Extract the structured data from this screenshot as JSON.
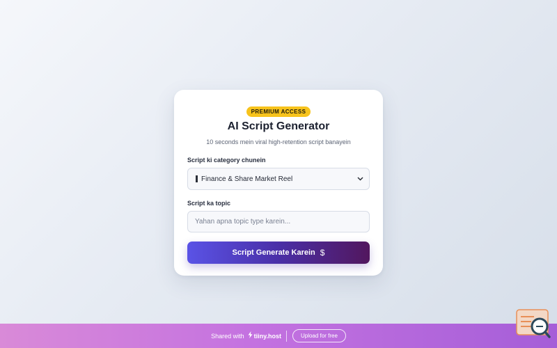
{
  "card": {
    "badge": "PREMIUM ACCESS",
    "title": "AI Script Generator",
    "subtitle": "10 seconds mein viral high-retention script banayein",
    "category": {
      "label": "Script ki category chunein",
      "selected": "Finance & Share Market Reel"
    },
    "topic": {
      "label": "Script ka topic",
      "placeholder": "Yahan apna topic type karein..."
    },
    "button": {
      "label": "Script Generate Karein",
      "icon": "$"
    }
  },
  "footer": {
    "shared_with": "Shared with",
    "brand": "tiiny.host",
    "upload": "Upload for free"
  },
  "colors": {
    "badge": "#f7c31c",
    "button_start": "#5a53e6",
    "button_end": "#52175e",
    "footer_start": "#d98ad8",
    "footer_end": "#a55ed8"
  }
}
